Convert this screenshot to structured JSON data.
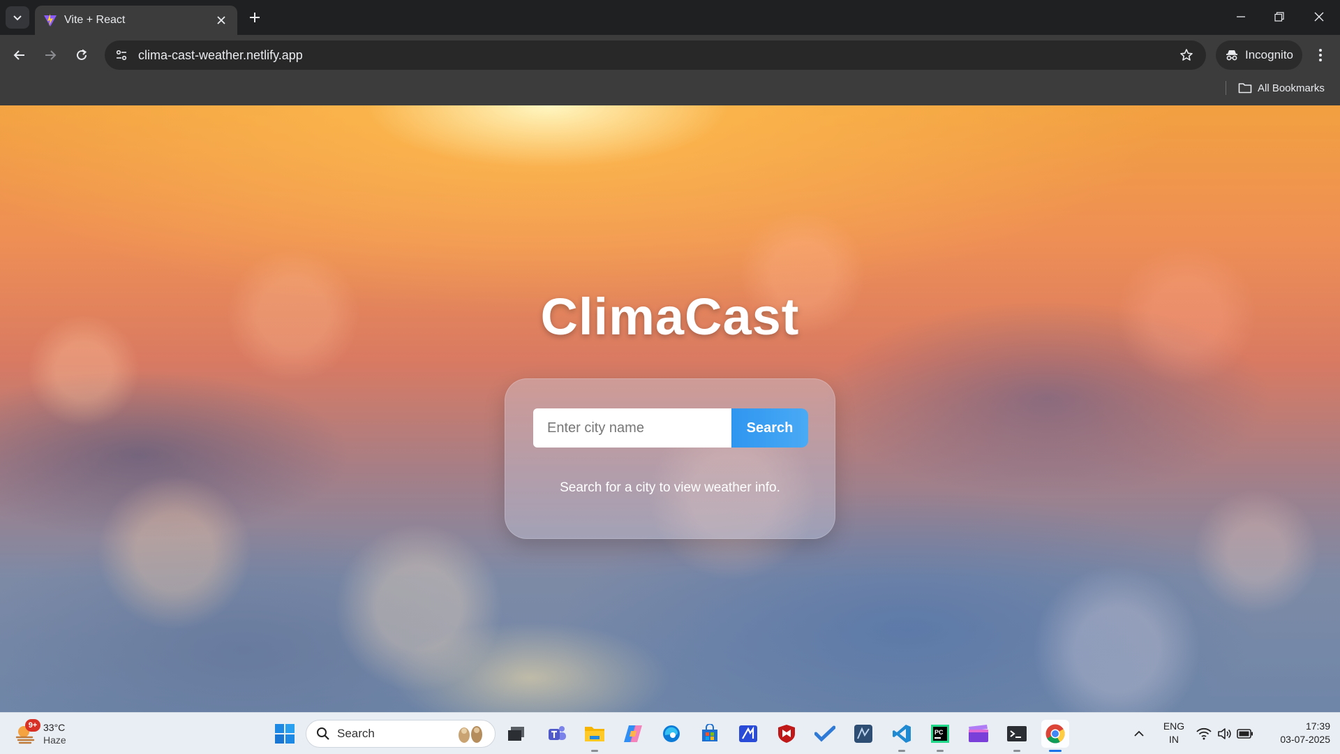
{
  "browser": {
    "tab": {
      "title": "Vite + React"
    },
    "url": "clima-cast-weather.netlify.app",
    "profile_label": "Incognito",
    "bookmarks_label": "All Bookmarks"
  },
  "page": {
    "title": "ClimaCast",
    "search": {
      "placeholder": "Enter city name",
      "value": "",
      "button_label": "Search"
    },
    "hint": "Search for a city to view weather info."
  },
  "taskbar": {
    "weather": {
      "temp": "33°C",
      "condition": "Haze",
      "badge": "9+"
    },
    "search_label": "Search",
    "apps": [
      "task-view",
      "teams",
      "file-explorer",
      "copilot",
      "edge",
      "microsoft-store",
      "app-blue",
      "mcafee",
      "todo",
      "app-dark",
      "vscode",
      "pycharm",
      "clipchamp",
      "terminal",
      "chrome"
    ],
    "active_app": "chrome",
    "language": {
      "line1": "ENG",
      "line2": "IN"
    },
    "clock": {
      "time": "17:39",
      "date": "03-07-2025"
    }
  },
  "colors": {
    "accent": "#2f96f0",
    "title": "#ffffff",
    "chrome_dark": "#3c3c3c"
  }
}
